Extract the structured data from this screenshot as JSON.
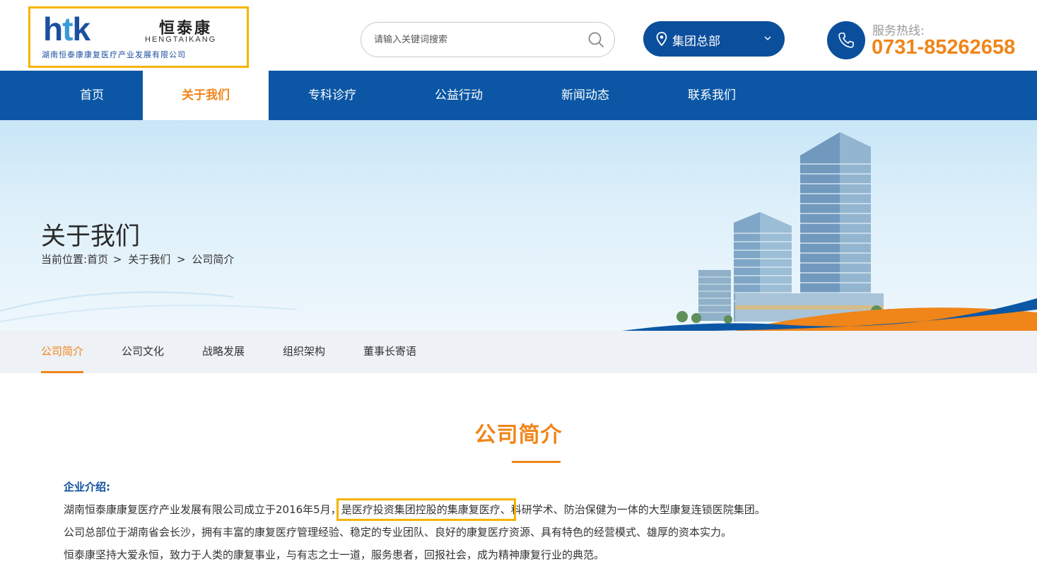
{
  "header": {
    "logo_mark_h": "h",
    "logo_mark_t": "t",
    "logo_mark_k": "k",
    "logo_cn": "恒泰康",
    "logo_en": "HENGTAIKANG",
    "logo_sub": "湖南恒泰康康复医疗产业发展有限公司",
    "search_placeholder": "请输入关键词搜索",
    "group_label": "集团总部",
    "hotline_label": "服务热线:",
    "hotline_number": "0731-85262658"
  },
  "nav": {
    "items": [
      {
        "label": "首页"
      },
      {
        "label": "关于我们"
      },
      {
        "label": "专科诊疗"
      },
      {
        "label": "公益行动"
      },
      {
        "label": "新闻动态"
      },
      {
        "label": "联系我们"
      }
    ],
    "active_index": 1
  },
  "banner": {
    "title": "关于我们",
    "crumb_prefix": "当前位置:",
    "crumbs": [
      "首页",
      ">",
      "关于我们",
      ">",
      "公司简介"
    ]
  },
  "subnav": {
    "items": [
      {
        "label": "公司简介"
      },
      {
        "label": "公司文化"
      },
      {
        "label": "战略发展"
      },
      {
        "label": "组织架构"
      },
      {
        "label": "董事长寄语"
      }
    ],
    "active_index": 0
  },
  "content": {
    "section_title": "公司简介",
    "intro_heading": "企业介绍:",
    "para1_before": "湖南恒泰康康复医疗产业发展有限公司成立于2016年5月，",
    "para1_highlight": "是医疗投资集团控股的集康复医疗、",
    "para1_after": "科研学术、防治保健为一体的大型康复连锁医院集团。",
    "para2": "公司总部位于湖南省会长沙，拥有丰富的康复医疗管理经验、稳定的专业团队、良好的康复医疗资源、具有特色的经营模式、雄厚的资本实力。",
    "para3": "恒泰康坚持大爱永恒，致力于人类的康复事业，与有志之士一道，服务患者，回报社会，成为精神康复行业的典范。"
  },
  "colors": {
    "brand_blue": "#0b57a5",
    "accent_orange": "#f08519",
    "highlight_box": "#f5b400"
  },
  "icons": [
    "search-icon",
    "location-pin-icon",
    "chevron-down-icon",
    "phone-icon"
  ]
}
